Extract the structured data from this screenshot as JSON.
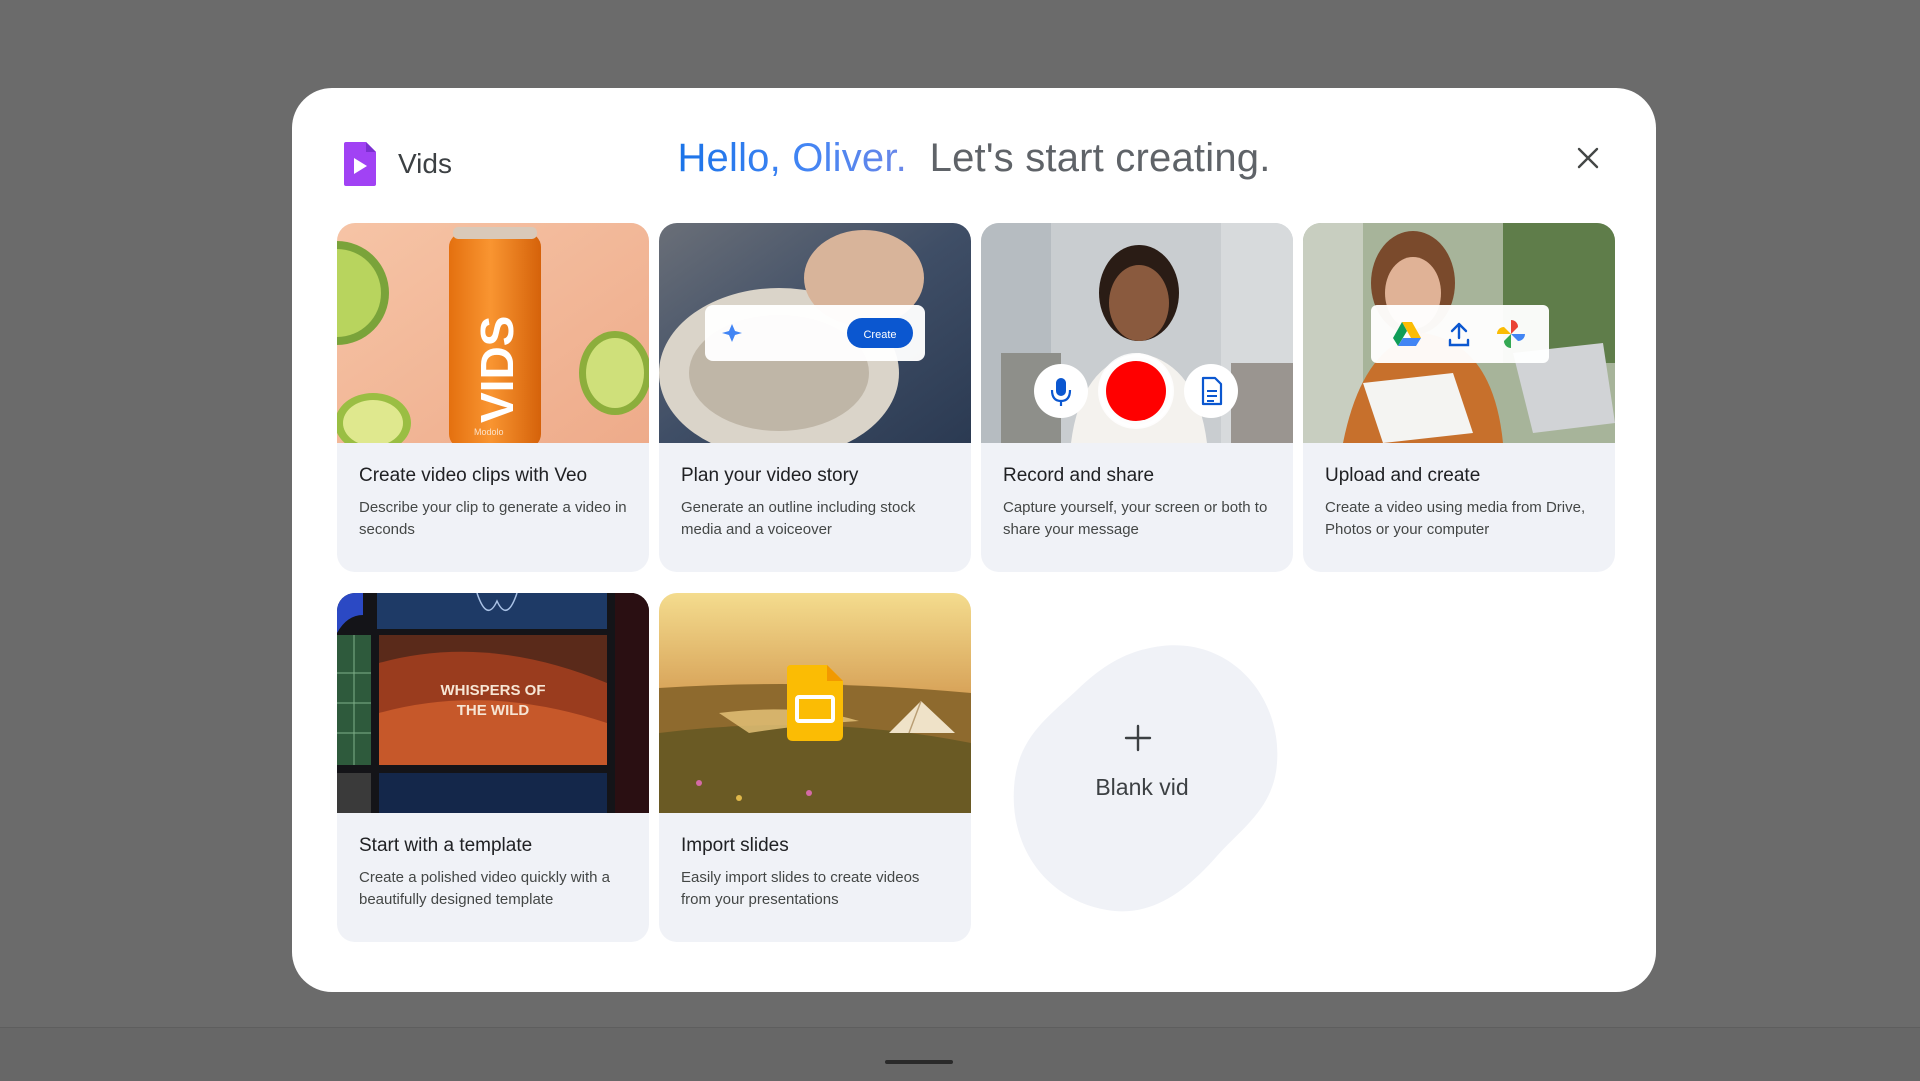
{
  "app": {
    "name": "Vids"
  },
  "header": {
    "hello": "Hello, Oliver.",
    "tagline": "Let's start creating."
  },
  "cards": [
    {
      "title": "Create video clips with Veo",
      "desc": "Describe your clip to generate a video in seconds",
      "can_text": "VIDS",
      "small_text": "Modolo"
    },
    {
      "title": "Plan your video story",
      "desc": "Generate an outline including stock media and a voiceover",
      "button_label": "Create"
    },
    {
      "title": "Record and share",
      "desc": "Capture yourself, your screen or both to share your message"
    },
    {
      "title": "Upload and create",
      "desc": "Create a video using media from Drive, Photos or your computer"
    },
    {
      "title": "Start with a template",
      "desc": "Create a polished video quickly with a beautifully designed template",
      "template_text_1": "WHISPERS OF",
      "template_text_2": "THE WILD"
    },
    {
      "title": "Import slides",
      "desc": "Easily import slides to create videos from your presentations"
    }
  ],
  "blank": {
    "label": "Blank vid"
  },
  "colors": {
    "accent_blue": "#1a73e8",
    "record_red": "#ff0000",
    "card_bg": "#f0f2f7",
    "slides_yellow": "#fbbc04",
    "vids_purple": "#a142f4"
  },
  "icons": [
    "vids-logo-icon",
    "close-icon",
    "sparkle-icon",
    "mic-icon",
    "record-icon",
    "document-icon",
    "drive-icon",
    "upload-icon",
    "photos-icon",
    "slides-icon",
    "plus-icon"
  ]
}
